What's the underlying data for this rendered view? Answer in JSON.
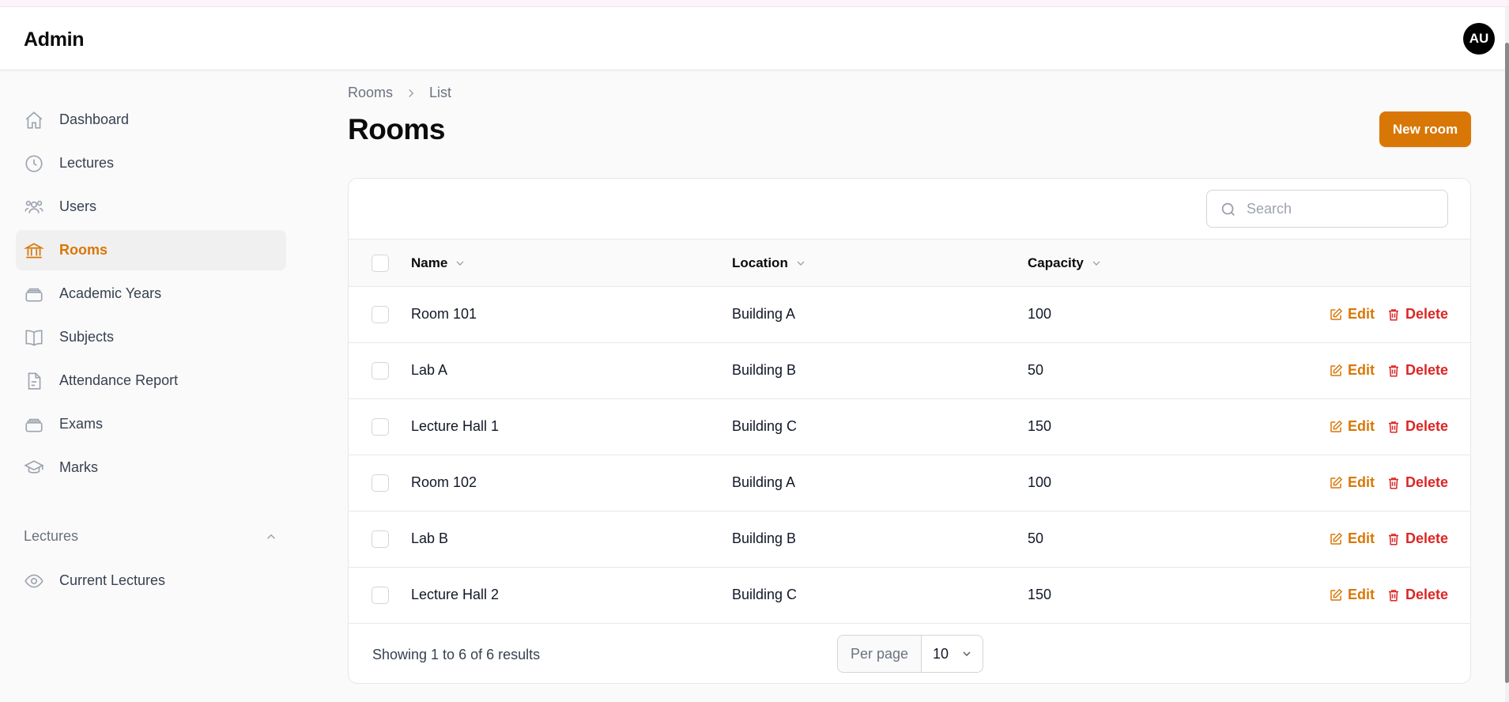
{
  "app": {
    "title": "Admin",
    "avatar_initials": "AU"
  },
  "sidebar": {
    "items": [
      {
        "label": "Dashboard",
        "icon": "home-icon",
        "active": false
      },
      {
        "label": "Lectures",
        "icon": "clock-icon",
        "active": false
      },
      {
        "label": "Users",
        "icon": "users-icon",
        "active": false
      },
      {
        "label": "Rooms",
        "icon": "building-columns-icon",
        "active": true
      },
      {
        "label": "Academic Years",
        "icon": "stack-icon",
        "active": false
      },
      {
        "label": "Subjects",
        "icon": "book-open-icon",
        "active": false
      },
      {
        "label": "Attendance Report",
        "icon": "document-icon",
        "active": false
      },
      {
        "label": "Exams",
        "icon": "stack-icon",
        "active": false
      },
      {
        "label": "Marks",
        "icon": "graduation-cap-icon",
        "active": false
      }
    ],
    "group": {
      "label": "Lectures",
      "expanded": true
    },
    "group_items": [
      {
        "label": "Current Lectures",
        "icon": "eye-icon"
      }
    ]
  },
  "breadcrumb": {
    "root": "Rooms",
    "current": "List"
  },
  "page": {
    "title": "Rooms",
    "new_button": "New room"
  },
  "search": {
    "placeholder": "Search",
    "value": ""
  },
  "table": {
    "columns": {
      "name": "Name",
      "location": "Location",
      "capacity": "Capacity"
    },
    "rows": [
      {
        "name": "Room 101",
        "location": "Building A",
        "capacity": "100"
      },
      {
        "name": "Lab A",
        "location": "Building B",
        "capacity": "50"
      },
      {
        "name": "Lecture Hall 1",
        "location": "Building C",
        "capacity": "150"
      },
      {
        "name": "Room 102",
        "location": "Building A",
        "capacity": "100"
      },
      {
        "name": "Lab B",
        "location": "Building B",
        "capacity": "50"
      },
      {
        "name": "Lecture Hall 2",
        "location": "Building C",
        "capacity": "150"
      }
    ],
    "row_actions": {
      "edit": "Edit",
      "delete": "Delete"
    }
  },
  "pagination": {
    "summary": "Showing 1 to 6 of 6 results",
    "per_page_label": "Per page",
    "per_page_value": "10"
  },
  "colors": {
    "accent": "#d97706",
    "danger": "#dc2626"
  }
}
